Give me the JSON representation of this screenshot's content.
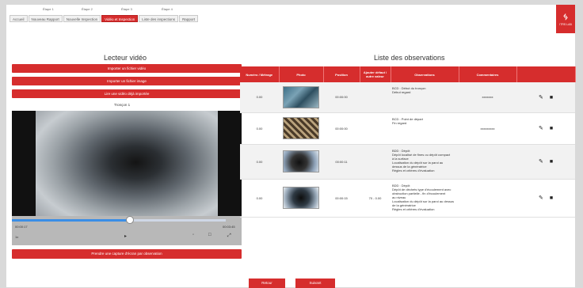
{
  "steps": [
    "Étape 1",
    "Étape 2",
    "Étape 3",
    "Étape 4"
  ],
  "tabs": [
    {
      "label": "Accueil",
      "active": false
    },
    {
      "label": "Nouveau Rapport",
      "active": false
    },
    {
      "label": "Nouvelle Inspection",
      "active": false
    },
    {
      "label": "Vidéo et Inspection",
      "active": true
    },
    {
      "label": "Liste des inspections",
      "active": false
    },
    {
      "label": "Rapport",
      "active": false
    }
  ],
  "logo": {
    "text": "ITRS LAB"
  },
  "video_reader": {
    "title": "Lecteur vidéo",
    "import_video": "Importer un fichier vidéo",
    "import_image": "Importer un fichier image",
    "lire_video": "Lire une vidéo déjà importée",
    "tronçon": "Tronçon 1",
    "time_left": "00:00:17",
    "time_right": "00:03:45",
    "speed": "1x",
    "progress": 0.55,
    "capture_button": "Prendre une capture d'écran par observation"
  },
  "observations": {
    "title": "Liste des observations",
    "columns": [
      "Numéro / Métrage",
      "Photo",
      "Position",
      "Ajouter défaut / autre valeur",
      "Observations",
      "Commentaires",
      ""
    ],
    "rows": [
      {
        "num": "0.00",
        "position": "00:00:00",
        "value": "",
        "description": "BCD : Début du tronçon\nDébut regard",
        "comment": "xxxxxxx"
      },
      {
        "num": "0.00",
        "position": "00:00:00",
        "value": "",
        "description": "BCD : Point de départ\nFin regard",
        "comment": "xxxxxxxxx"
      },
      {
        "num": "0.00",
        "position": "00:00:11",
        "value": "",
        "description": "BDD : Dépôt\nDépôt localisé de fines ou dépôt compact\nà la surface\nLocalisation du dépôt sur la paroi au\ndessus de la génératrice\nRégles et critères d'évaluation",
        "comment": ""
      },
      {
        "num": "0.00",
        "position": "00:00:15",
        "value": "70 - 0.00",
        "description": "BDD : Dépôt\nDépôt de déchets type d'écoulement avec\nobstruction partielle - fin d'écoulement\nau niveau\nLocalisation du dépôt sur la paroi au dessus\nde la génératrice\nRégles et critères d'évaluation",
        "comment": ""
      }
    ]
  },
  "footer": {
    "cancel": "Retour",
    "validate": "Suivant"
  },
  "colors": {
    "accent": "#d62d2d"
  }
}
